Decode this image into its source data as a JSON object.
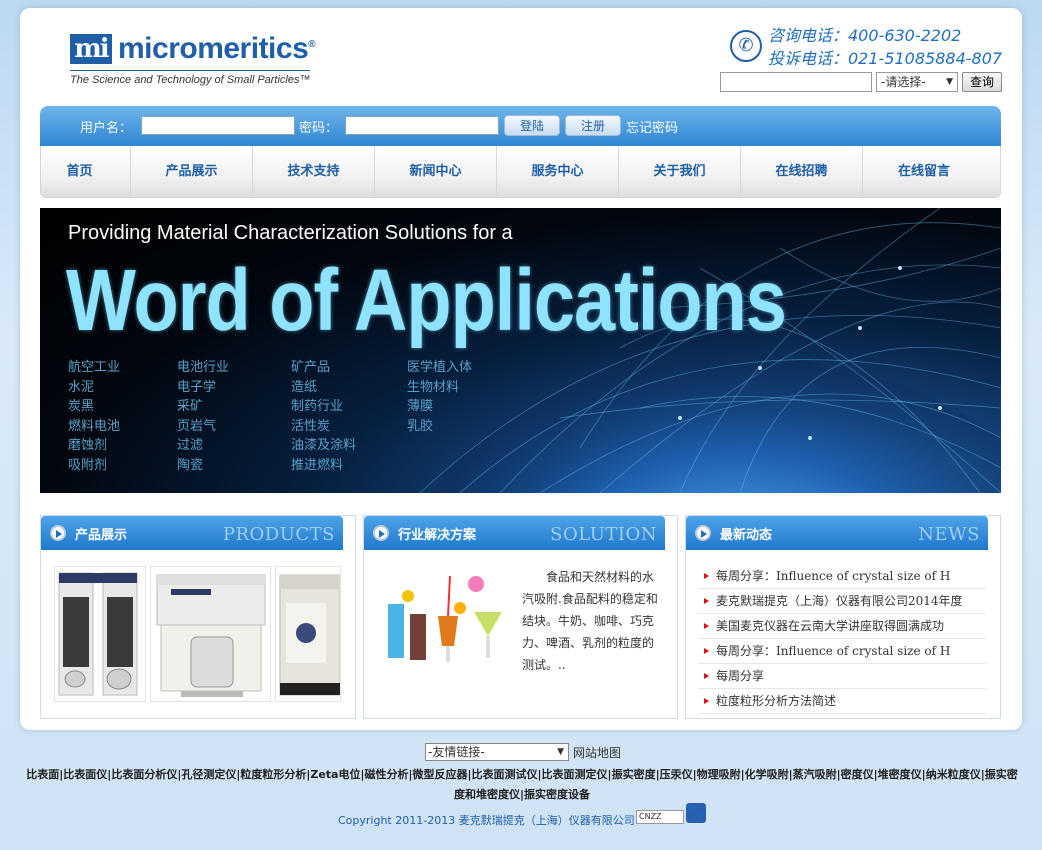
{
  "header": {
    "logo_mark": "mi",
    "logo_text": "micromeritics",
    "logo_reg": "®",
    "tagline": "The Science and Technology of Small Particles™",
    "phone_consult": "咨询电话：400-630-2202",
    "phone_complaint": "投诉电话：021-51085884-807",
    "search_select": "-请选择-",
    "search_button": "查询"
  },
  "login": {
    "username_label": "用户名：",
    "password_label": "密码：",
    "login_button": "登陆",
    "register_button": "注册",
    "forgot_link": "忘记密码"
  },
  "nav": {
    "items": [
      "首页",
      "产品展示",
      "技术支持",
      "新闻中心",
      "服务中心",
      "关于我们",
      "在线招聘",
      "在线留言"
    ]
  },
  "banner": {
    "tagline": "Providing Material Characterization Solutions for a",
    "title": "Word of Applications",
    "applications": [
      [
        "航空工业",
        "水泥",
        "炭黑",
        "燃料电池",
        "磨蚀剂",
        "吸附剂"
      ],
      [
        "电池行业",
        "电子学",
        "采矿",
        "页岩气",
        "过滤",
        "陶瓷"
      ],
      [
        "矿产品",
        "造纸",
        "制药行业",
        "活性炭",
        "油漆及涂料",
        "推进燃料"
      ],
      [
        "医学植入体",
        "生物材料",
        "薄膜",
        "乳胶"
      ]
    ]
  },
  "panels": {
    "products": {
      "title": "产品展示",
      "en": "PRODUCTS"
    },
    "solution": {
      "title": "行业解决方案",
      "en": "SOLUTION",
      "text": "食品和天然材料的水汽吸附.食品配料的稳定和结块。牛奶、咖啡、巧克力、啤酒、乳剂的粒度的测试。.."
    },
    "news": {
      "title": "最新动态",
      "en": "NEWS",
      "items": [
        "每周分享：Influence of crystal size of H",
        "麦克默瑞提克（上海）仪器有限公司2014年度",
        "美国麦克仪器在云南大学讲座取得圆满成功",
        "每周分享：Influence of crystal size of H",
        "每周分享",
        "粒度粒形分析方法简述"
      ]
    }
  },
  "footer": {
    "links_select": "-友情链接-",
    "sitemap": "网站地图",
    "links": "比表面|比表面仪|比表面分析仪|孔径测定仪|粒度粒形分析|Zeta电位|磁性分析|微型反应器|比表面测试仪|比表面测定仪|振实密度|压汞仪|物理吸附|化学吸附|蒸汽吸附|密度仪|堆密度仪|纳米粒度仪|振实密度和堆密度仪|振实密度设备",
    "copyright": "Copyright 2011-2013  麦克默瑞提克（上海）仪器有限公司",
    "cnzz": "CNZZ"
  }
}
